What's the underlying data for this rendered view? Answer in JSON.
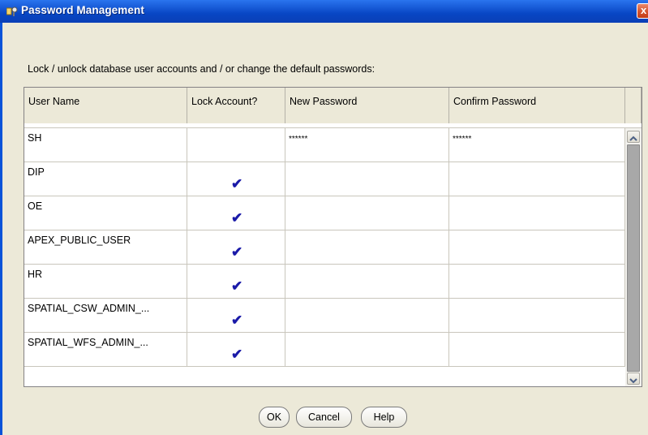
{
  "window": {
    "title": "Password Management",
    "close_label": "x"
  },
  "instruction": "Lock / unlock database user accounts and / or change the default passwords:",
  "table": {
    "headers": [
      "User Name",
      "Lock Account?",
      "New Password",
      "Confirm Password"
    ],
    "rows": [
      {
        "user": "SH",
        "locked": false,
        "new_password": "******",
        "confirm_password": "******"
      },
      {
        "user": "DIP",
        "locked": true,
        "new_password": "",
        "confirm_password": ""
      },
      {
        "user": "OE",
        "locked": true,
        "new_password": "",
        "confirm_password": ""
      },
      {
        "user": "APEX_PUBLIC_USER",
        "locked": true,
        "new_password": "",
        "confirm_password": ""
      },
      {
        "user": "HR",
        "locked": true,
        "new_password": "",
        "confirm_password": ""
      },
      {
        "user": "SPATIAL_CSW_ADMIN_...",
        "locked": true,
        "new_password": "",
        "confirm_password": ""
      },
      {
        "user": "SPATIAL_WFS_ADMIN_...",
        "locked": true,
        "new_password": "",
        "confirm_password": ""
      }
    ],
    "check_glyph": "✔"
  },
  "buttons": {
    "ok": "OK",
    "cancel": "Cancel",
    "help": "Help"
  },
  "icons": {
    "title": "key-user-icon",
    "close": "close-icon",
    "scroll_up": "scroll-up-arrow-icon",
    "scroll_down": "scroll-down-arrow-icon",
    "check": "checkmark-icon"
  },
  "colors": {
    "titlebar": "#0846c4",
    "client_bg": "#ece9d8",
    "check": "#1a1aa8",
    "close": "#d5532d"
  }
}
